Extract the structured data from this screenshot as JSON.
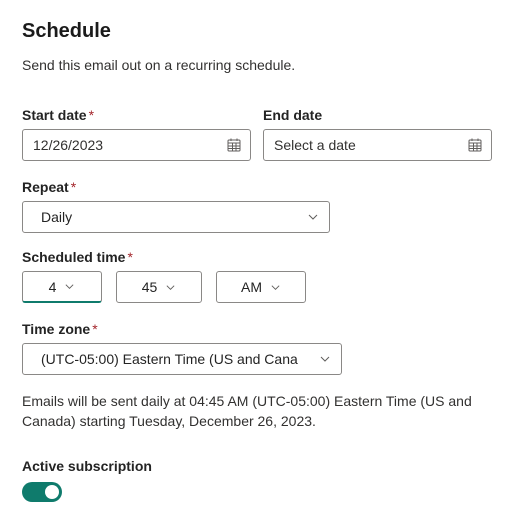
{
  "title": "Schedule",
  "subtitle": "Send this email out on a recurring schedule.",
  "startDate": {
    "label": "Start date",
    "required": true,
    "value": "12/26/2023"
  },
  "endDate": {
    "label": "End date",
    "required": false,
    "placeholder": "Select a date"
  },
  "repeat": {
    "label": "Repeat",
    "required": true,
    "value": "Daily"
  },
  "scheduledTime": {
    "label": "Scheduled time",
    "required": true,
    "hour": "4",
    "minute": "45",
    "ampm": "AM"
  },
  "timeZone": {
    "label": "Time zone",
    "required": true,
    "value": "(UTC-05:00) Eastern Time (US and Cana"
  },
  "summary": "Emails will be sent daily at 04:45 AM (UTC-05:00) Eastern Time (US and Canada) starting Tuesday, December 26, 2023.",
  "activeSubscription": {
    "label": "Active subscription",
    "on": true
  }
}
